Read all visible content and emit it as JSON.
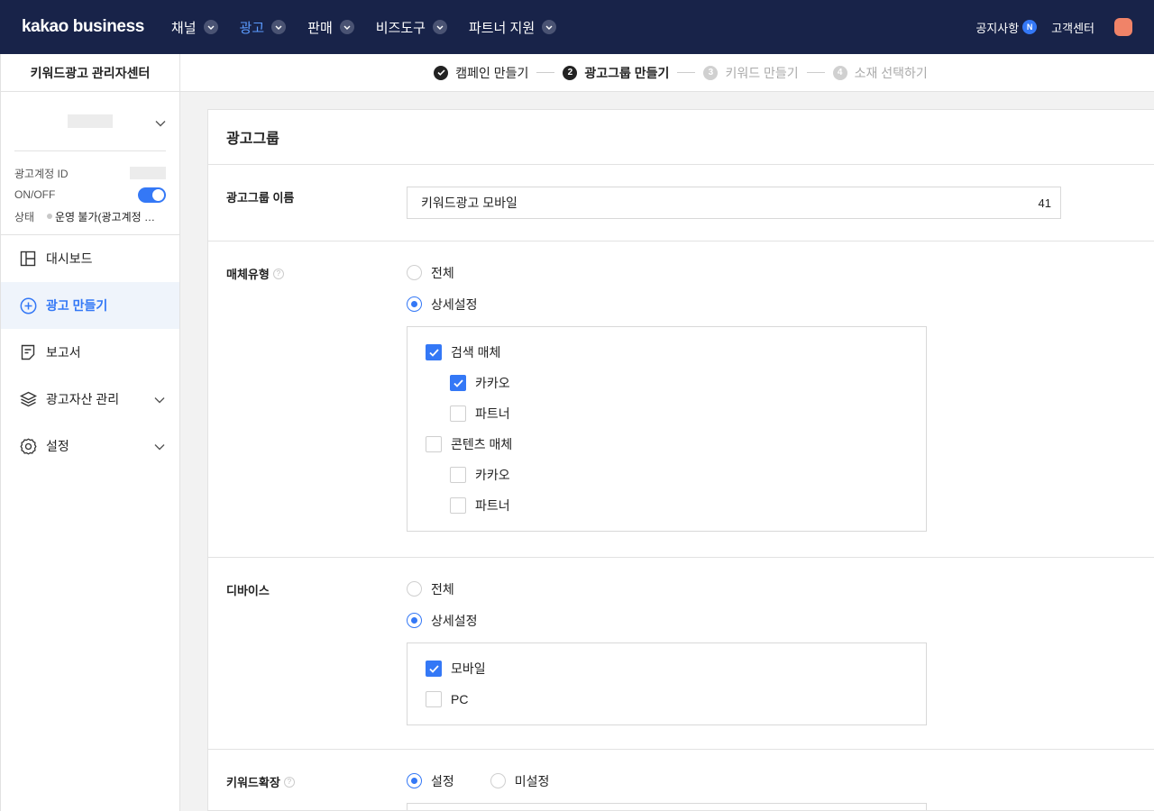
{
  "topnav": {
    "logo": "kakao business",
    "items": [
      {
        "label": "채널"
      },
      {
        "label": "광고"
      },
      {
        "label": "판매"
      },
      {
        "label": "비즈도구"
      },
      {
        "label": "파트너 지원"
      }
    ],
    "active_item": "광고",
    "notice_label": "공지사항",
    "notice_badge": "N",
    "support_label": "고객센터"
  },
  "sidebar": {
    "title": "키워드광고 관리자센터",
    "account": {
      "id_label": "광고계정 ID",
      "onoff_label": "ON/OFF",
      "onoff_state": "on",
      "status_label": "상태",
      "status_value": "운영 불가(광고계정 …"
    },
    "menu": [
      {
        "label": "대시보드",
        "icon": "dashboard-icon"
      },
      {
        "label": "광고 만들기",
        "icon": "plus-circle-icon",
        "active": true
      },
      {
        "label": "보고서",
        "icon": "report-icon"
      },
      {
        "label": "광고자산 관리",
        "icon": "layers-icon",
        "expandable": true
      },
      {
        "label": "설정",
        "icon": "gear-icon",
        "expandable": true
      }
    ]
  },
  "steps": [
    {
      "num": "✓",
      "label": "캠페인 만들기",
      "state": "done"
    },
    {
      "num": "2",
      "label": "광고그룹 만들기",
      "state": "current"
    },
    {
      "num": "3",
      "label": "키워드 만들기",
      "state": "pending"
    },
    {
      "num": "4",
      "label": "소재 선택하기",
      "state": "pending"
    }
  ],
  "adgroup": {
    "heading": "광고그룹",
    "name_label": "광고그룹 이름",
    "name_value": "키워드광고 모바일",
    "name_char_count": "41",
    "media_label": "매체유형",
    "media_options": [
      "전체",
      "상세설정"
    ],
    "media_selected": "상세설정",
    "media_checks": [
      {
        "label": "검색 매체",
        "checked": true,
        "level": 0
      },
      {
        "label": "카카오",
        "checked": true,
        "level": 1
      },
      {
        "label": "파트너",
        "checked": false,
        "level": 1
      },
      {
        "label": "콘텐츠 매체",
        "checked": false,
        "level": 0
      },
      {
        "label": "카카오",
        "checked": false,
        "level": 1
      },
      {
        "label": "파트너",
        "checked": false,
        "level": 1
      }
    ],
    "device_label": "디바이스",
    "device_options": [
      "전체",
      "상세설정"
    ],
    "device_selected": "상세설정",
    "device_checks": [
      {
        "label": "모바일",
        "checked": true
      },
      {
        "label": "PC",
        "checked": false
      }
    ],
    "keyword_ext_label": "키워드확장",
    "keyword_ext_options": [
      "설정",
      "미설정"
    ],
    "keyword_ext_selected": "설정",
    "help_glyph": "?"
  },
  "colors": {
    "nav_bg": "#182349",
    "accent": "#3478f6",
    "active_nav": "#5b9bff",
    "avatar": "#f08368"
  }
}
